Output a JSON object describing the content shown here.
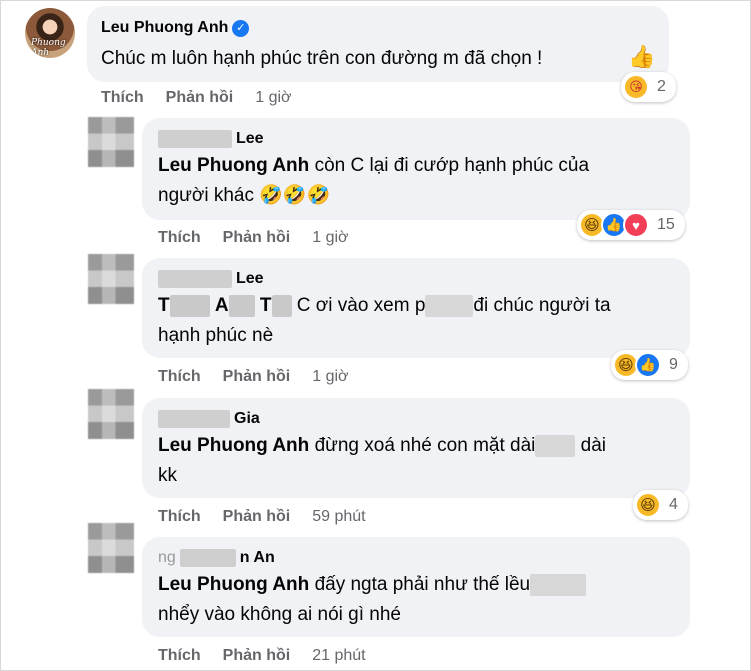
{
  "colors": {
    "bubble": "#f0f2f5",
    "meta_text": "#65676b",
    "verified": "#1877f2",
    "haha": "#f7b928"
  },
  "actions": {
    "like": "Thích",
    "reply": "Phản hồi"
  },
  "comments": [
    {
      "author": "Leu Phuong Anh",
      "avatar_watermark": "Phuong Anh",
      "verified": true,
      "text_line1": "Chúc m luôn hạnh phúc trên con đường m đã chọn !",
      "trailing_emoji": "👍",
      "time": "1 giờ",
      "reaction_icons": [
        "care-emoji-icon"
      ],
      "reactions": "2"
    },
    {
      "author_visible": "Lee",
      "mention": "Leu Phuong Anh",
      "text_line1_rest": "còn C lại đi cướp hạnh phúc của",
      "text_line2": "người khác",
      "text_emoji": "🤣🤣🤣",
      "time": "1 giờ",
      "reaction_icons": [
        "haha-icon",
        "like-icon",
        "love-icon"
      ],
      "reactions": "15"
    },
    {
      "author_visible": "Lee",
      "line1_t1": "T",
      "line1_a": "A",
      "line1_t2": "T",
      "line1_mid": "C ơi vào xem p",
      "line1_end": "đi chúc người ta",
      "text_line2": "hạnh phúc nè",
      "time": "1 giờ",
      "reaction_icons": [
        "haha-icon",
        "like-icon"
      ],
      "reactions": "9"
    },
    {
      "author_visible": "Gia",
      "mention": "Leu Phuong Anh",
      "text_line1_rest": "đừng xoá nhé con mặt dài",
      "text_line1_end": "dài",
      "text_line2": "kk",
      "time": "59 phút",
      "reaction_icons": [
        "haha-icon"
      ],
      "reactions": "4"
    },
    {
      "author_visible_pre": "ng",
      "author_visible": "n An",
      "mention": "Leu Phuong Anh",
      "text_line1_rest": "đấy ngta phải như thế lều",
      "text_line2": "nhểy vào không ai nói gì nhé",
      "time": "21 phút"
    }
  ]
}
